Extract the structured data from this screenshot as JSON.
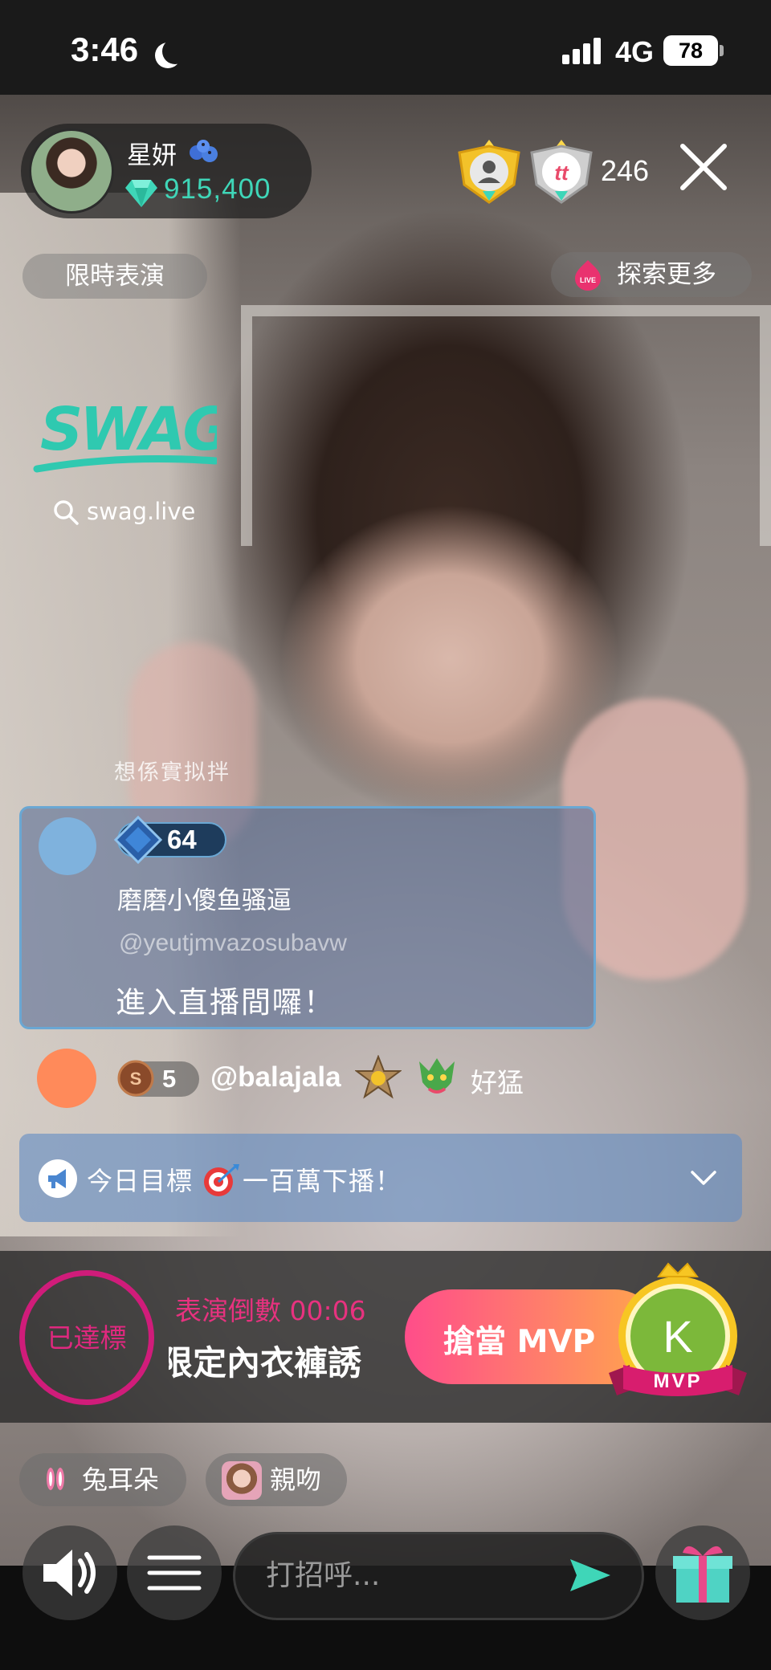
{
  "status_bar": {
    "time": "3:46",
    "network": "4G",
    "battery": "78"
  },
  "streamer": {
    "name": "星妍",
    "coins": "915,400"
  },
  "viewers": {
    "count": "246"
  },
  "tags": {
    "limited_show": "限時表演",
    "explore_more": "探索更多",
    "live_badge": "LIVE"
  },
  "watermark": {
    "logo_text": "SWAG",
    "site": "swag.live",
    "faded_caption": "想係實拟拌"
  },
  "join_message": {
    "level": "64",
    "name": "磨磨小傻鱼骚逼",
    "handle": "@yeutjmvazosubavw",
    "text": "進入直播間囉！"
  },
  "chat_message": {
    "coin_letter": "S",
    "level": "5",
    "username": "@balajala",
    "text": "好猛"
  },
  "goal": {
    "text_before": "今日目標",
    "text_after": "一百萬下播！"
  },
  "performance": {
    "achieved": "已達標",
    "countdown": "表演倒數 00:06",
    "title": "限定內衣褲誘",
    "mvp_button": "搶當 MVP",
    "mvp_initial": "K",
    "mvp_ribbon": "MVP"
  },
  "quick_gifts": [
    {
      "label": "兔耳朵",
      "icon": "rabbit-icon"
    },
    {
      "label": "親吻",
      "icon": "kiss-icon"
    }
  ],
  "chat_input": {
    "placeholder": "打招呼..."
  },
  "colors": {
    "accent_teal": "#3fd6b8",
    "accent_pink": "#e7327f",
    "goal_blue": "#628cc4"
  }
}
